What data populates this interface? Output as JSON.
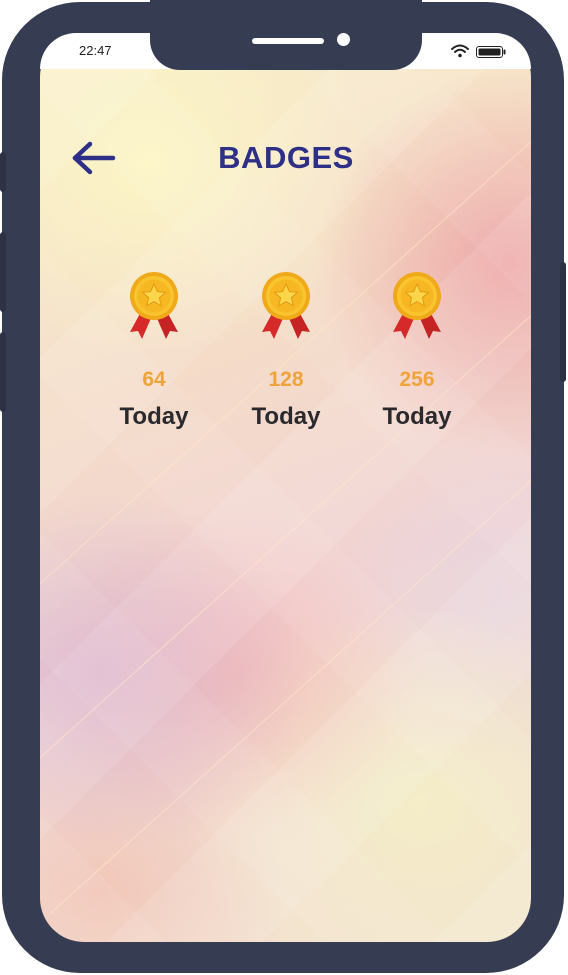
{
  "status_bar": {
    "time": "22:47",
    "icons": [
      "wifi-icon",
      "battery-icon"
    ]
  },
  "header": {
    "back_icon": "arrow-left-icon",
    "title": "BADGES"
  },
  "badges": [
    {
      "icon": "medal-icon",
      "count": "64",
      "label": "Today"
    },
    {
      "icon": "medal-icon",
      "count": "128",
      "label": "Today"
    },
    {
      "icon": "medal-icon",
      "count": "256",
      "label": "Today"
    }
  ],
  "colors": {
    "frame": "#363c52",
    "title": "#2e2f86",
    "count": "#eea43a",
    "label": "#2a2a2e",
    "medal_gold": "#f4b81c",
    "ribbon_red": "#d62a2a"
  }
}
